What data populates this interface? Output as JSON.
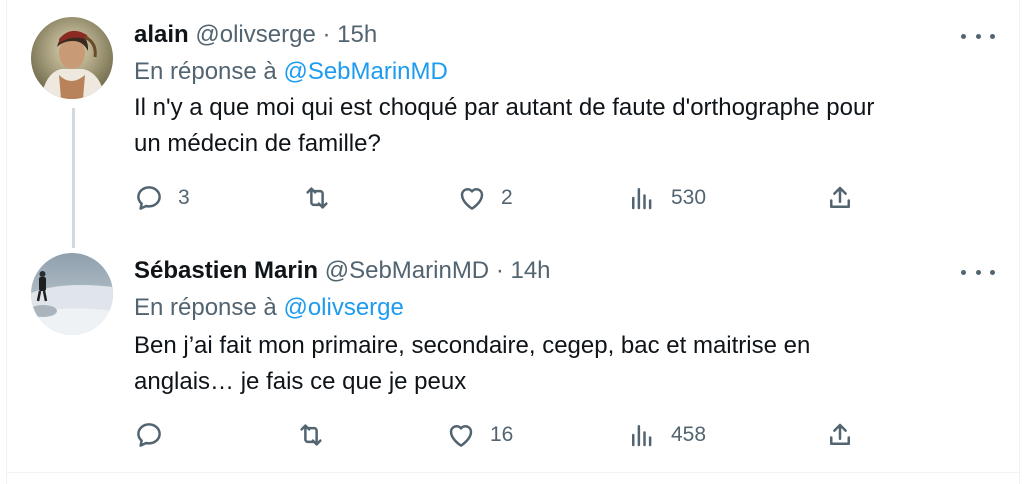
{
  "tweets": [
    {
      "name": "alain",
      "handle": "@olivserge",
      "dot": "·",
      "time": "15h",
      "reply_prefix": "En réponse à",
      "reply_to": "@SebMarinMD",
      "text_line1": "Il n'y a que moi qui est choqué par autant de faute d'orthographe pour",
      "text_line2": "un médecin de famille?",
      "replies": "3",
      "retweets": "",
      "likes": "2",
      "views": "530"
    },
    {
      "name": "Sébastien Marin",
      "handle": "@SebMarinMD",
      "dot": "·",
      "time": "14h",
      "reply_prefix": "En réponse à",
      "reply_to": "@olivserge",
      "text_line1": "Ben j’ai fait mon primaire, secondaire, cegep, bac et maitrise en",
      "text_line2": "anglais… je fais ce que je peux",
      "replies": "",
      "retweets": "",
      "likes": "16",
      "views": "458"
    }
  ],
  "icons": {
    "reply": "reply-icon",
    "retweet": "retweet-icon",
    "like": "heart-icon",
    "views": "views-icon",
    "share": "share-icon",
    "more": "more-icon"
  },
  "colors": {
    "text": "#0f1419",
    "secondary": "#536471",
    "link": "#1d9bf0",
    "thread_line": "#cfd9de"
  }
}
